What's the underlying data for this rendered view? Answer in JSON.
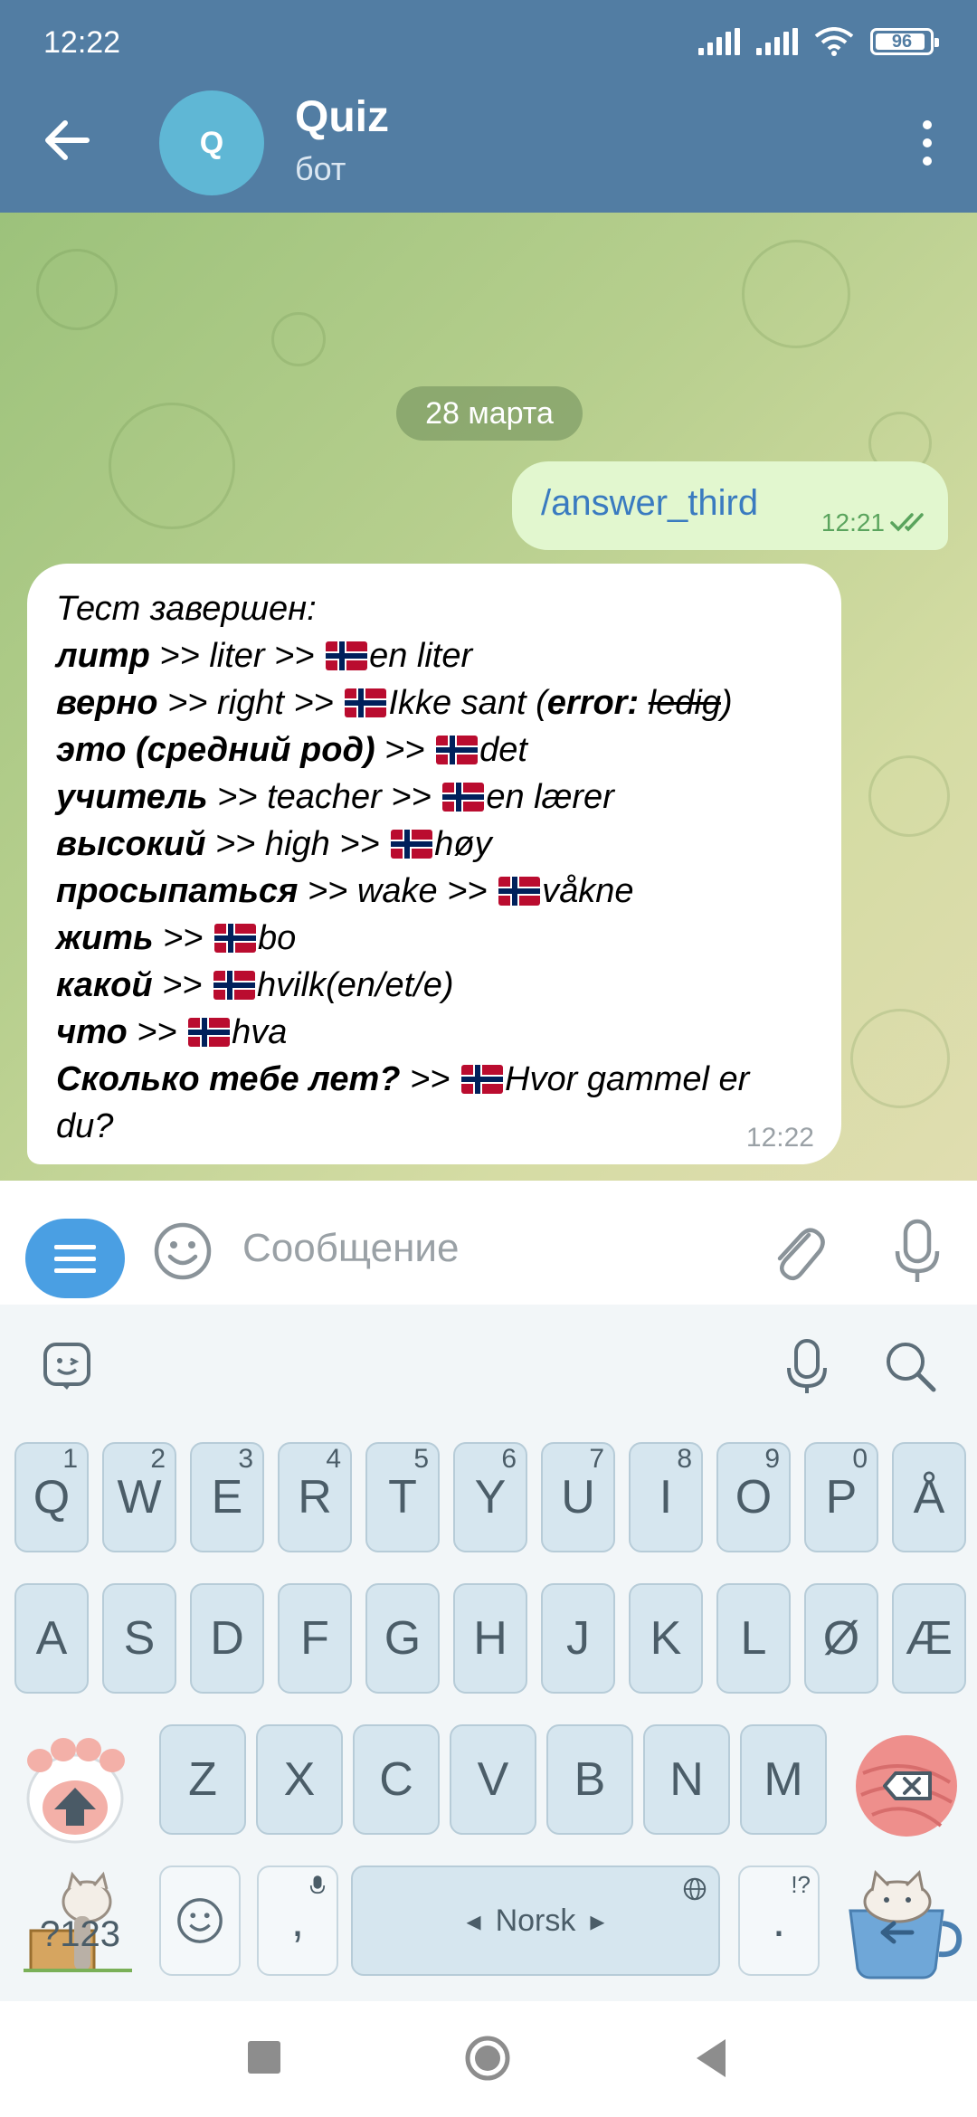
{
  "status_bar": {
    "time": "12:22",
    "battery": "96"
  },
  "header": {
    "avatar_letter": "Q",
    "title": "Quiz",
    "subtitle": "бот"
  },
  "chat": {
    "date_chip": "28 марта",
    "outgoing": {
      "text": "/answer_third",
      "time": "12:21"
    },
    "incoming": {
      "time": "12:22",
      "heading": "Тест завершен:",
      "rows": [
        {
          "ru": "литр",
          "en": " >> liter >> ",
          "no": "en liter"
        },
        {
          "ru": "верно",
          "en": " >> right >> ",
          "no": "Ikke sant",
          "error_label": "error:",
          "error_value": "ledig"
        },
        {
          "ru": "это (средний род)",
          "en": " >> ",
          "no": "det"
        },
        {
          "ru": "учитель",
          "en": " >> teacher >> ",
          "no": "en lærer"
        },
        {
          "ru": "высокий",
          "en": " >> high >> ",
          "no": "høy"
        },
        {
          "ru": "просыпаться",
          "en": " >> wake >> ",
          "no": "våkne"
        },
        {
          "ru": "жить",
          "en": " >> ",
          "no": "bo"
        },
        {
          "ru": "какой",
          "en": " >> ",
          "no": "hvilk(en/et/e)"
        },
        {
          "ru": "что",
          "en": " >> ",
          "no": "hva"
        },
        {
          "ru": "Сколько тебе лет?",
          "en": " >> ",
          "no": "Hvor gammel er"
        }
      ],
      "tail": "du?"
    }
  },
  "composer": {
    "placeholder": "Сообщение"
  },
  "keyboard": {
    "row1": [
      {
        "k": "Q",
        "h": "1"
      },
      {
        "k": "W",
        "h": "2"
      },
      {
        "k": "E",
        "h": "3"
      },
      {
        "k": "R",
        "h": "4"
      },
      {
        "k": "T",
        "h": "5"
      },
      {
        "k": "Y",
        "h": "6"
      },
      {
        "k": "U",
        "h": "7"
      },
      {
        "k": "I",
        "h": "8"
      },
      {
        "k": "O",
        "h": "9"
      },
      {
        "k": "P",
        "h": "0"
      },
      {
        "k": "Å",
        "h": ""
      }
    ],
    "row2": [
      "A",
      "S",
      "D",
      "F",
      "G",
      "H",
      "J",
      "K",
      "L",
      "Ø",
      "Æ"
    ],
    "row3": [
      "Z",
      "X",
      "C",
      "V",
      "B",
      "N",
      "M"
    ],
    "num_label": "?123",
    "comma": ",",
    "space_label": "Norsk",
    "period": ".",
    "period_hint": "!?"
  }
}
